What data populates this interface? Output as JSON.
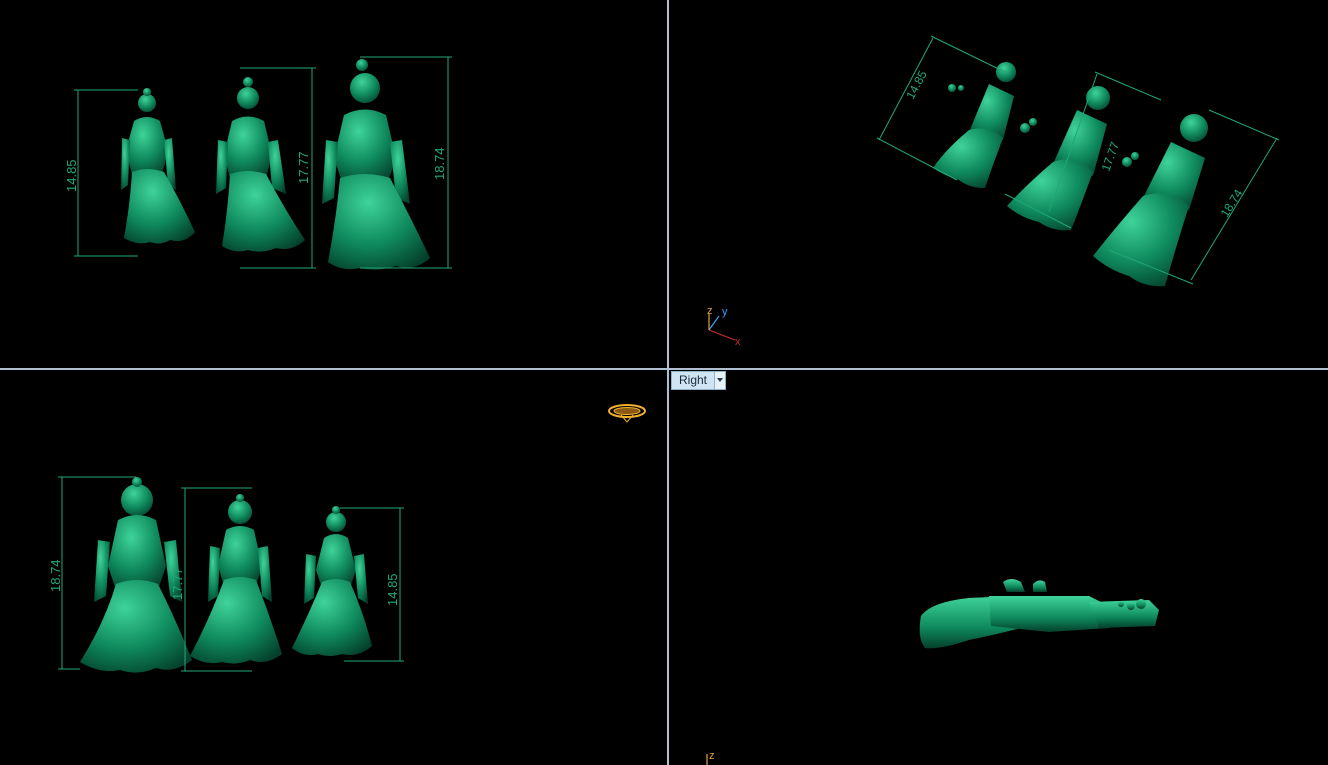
{
  "colors": {
    "background": "#000000",
    "divider": "#aebfd0",
    "model_green": "#0f8a5e",
    "dimension_green": "#1fa878",
    "axis_x": "#cc2a2a",
    "axis_y": "#3aa0ff",
    "axis_z": "#e0a040",
    "gumball": "#f0b030"
  },
  "viewports": {
    "top_left": {
      "dims": [
        "14.85",
        "17.77",
        "18.74"
      ]
    },
    "top_right": {
      "dims": [
        "14.85",
        "17.77",
        "18.74"
      ],
      "axis": {
        "x": "x",
        "y": "y",
        "z": "z"
      }
    },
    "bottom_left": {
      "dims": [
        "18.74",
        "17.77",
        "14.85"
      ]
    },
    "bottom_right": {
      "tab_label": "Right",
      "axis": {
        "z": "z"
      }
    }
  },
  "icons": {
    "tab_dropdown": "chevron-down-icon",
    "gumball": "gumball-icon",
    "axis_widget": "axis-triad-icon"
  }
}
